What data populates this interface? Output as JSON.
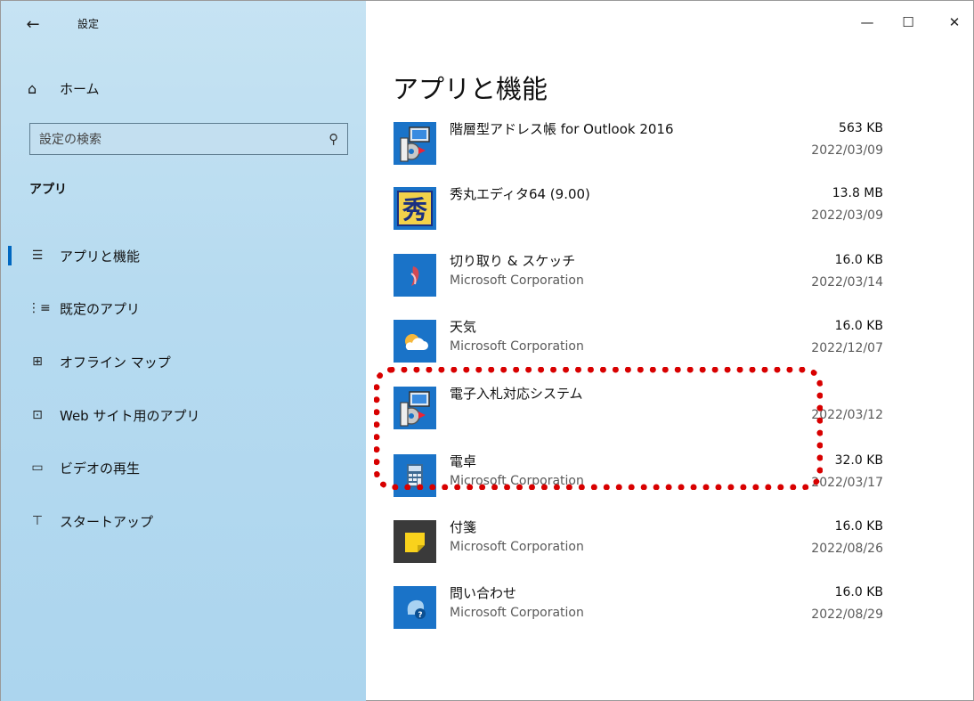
{
  "window": {
    "title": "設定",
    "back_glyph": "←",
    "minimize_glyph": "—",
    "maximize_glyph": "☐",
    "close_glyph": "✕"
  },
  "sidebar": {
    "home": {
      "label": "ホーム",
      "icon": "home-icon",
      "glyph": "⌂"
    },
    "search": {
      "placeholder": "設定の検索",
      "icon": "search-icon",
      "glyph": "⚲"
    },
    "section_heading": "アプリ",
    "items": [
      {
        "label": "アプリと機能",
        "icon": "apps-features-icon",
        "glyph": "☰",
        "selected": true
      },
      {
        "label": "既定のアプリ",
        "icon": "default-apps-icon",
        "glyph": "⋮≡"
      },
      {
        "label": "オフライン マップ",
        "icon": "offline-maps-icon",
        "glyph": "⊞"
      },
      {
        "label": "Web サイト用のアプリ",
        "icon": "apps-for-websites-icon",
        "glyph": "⊡"
      },
      {
        "label": "ビデオの再生",
        "icon": "video-playback-icon",
        "glyph": "▭"
      },
      {
        "label": "スタートアップ",
        "icon": "startup-icon",
        "glyph": "⊤"
      }
    ]
  },
  "main": {
    "title": "アプリと機能",
    "apps": [
      {
        "name": "階層型アドレス帳 for Outlook 2016",
        "publisher": "",
        "size": "563 KB",
        "date": "2022/03/09",
        "icon": "installer-icon"
      },
      {
        "name": "秀丸エディタ64 (9.00)",
        "publisher": "",
        "size": "13.8 MB",
        "date": "2022/03/09",
        "icon": "hidemaru-icon",
        "icon_glyph": "秀"
      },
      {
        "name": "切り取り & スケッチ",
        "publisher": "Microsoft Corporation",
        "size": "16.0 KB",
        "date": "2022/03/14",
        "icon": "snip-sketch-icon"
      },
      {
        "name": "天気",
        "publisher": "Microsoft Corporation",
        "size": "16.0 KB",
        "date": "2022/12/07",
        "icon": "weather-icon"
      },
      {
        "name": "電子入札対応システム",
        "publisher": "",
        "size": "",
        "date": "2022/03/12",
        "icon": "installer-icon"
      },
      {
        "name": "電卓",
        "publisher": "Microsoft Corporation",
        "size": "32.0 KB",
        "date": "2022/03/17",
        "icon": "calculator-icon"
      },
      {
        "name": "付箋",
        "publisher": "Microsoft Corporation",
        "size": "16.0 KB",
        "date": "2022/08/26",
        "icon": "sticky-notes-icon"
      },
      {
        "name": "問い合わせ",
        "publisher": "Microsoft Corporation",
        "size": "16.0 KB",
        "date": "2022/08/29",
        "icon": "get-help-icon",
        "icon_glyph": "?"
      }
    ]
  },
  "colors": {
    "accent": "#0067c0",
    "annotation": "#d80000",
    "sidebar_bg": "#b7dbf0",
    "tile_blue": "#1a73c8"
  }
}
